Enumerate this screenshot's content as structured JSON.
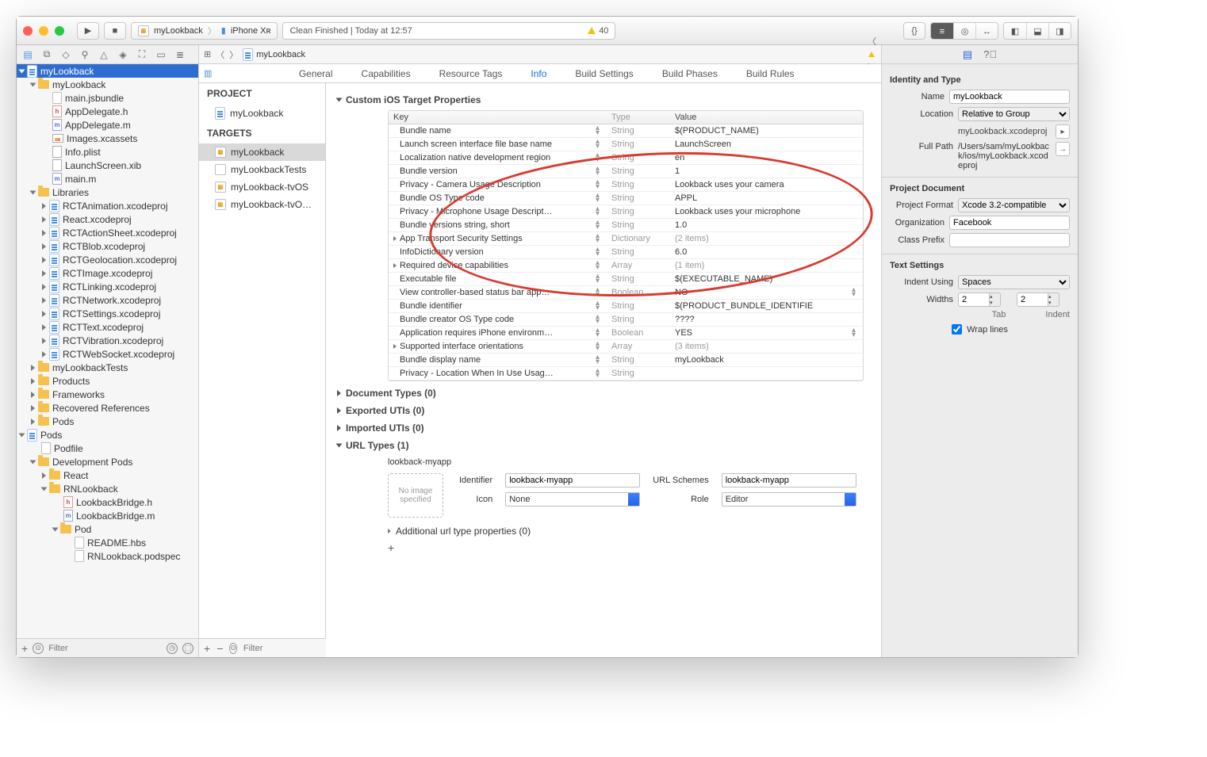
{
  "toolbar": {
    "scheme_target": "myLookback",
    "scheme_device": "iPhone Xʀ",
    "status_text": "Clean Finished | Today at 12:57",
    "warning_count": "40"
  },
  "navigator": {
    "root": "myLookback",
    "tree": [
      {
        "indent": 0,
        "type": "project",
        "name": "myLookback",
        "selected": true,
        "open": true
      },
      {
        "indent": 1,
        "type": "folder",
        "name": "myLookback",
        "open": true
      },
      {
        "indent": 2,
        "type": "file",
        "name": "main.jsbundle"
      },
      {
        "indent": 2,
        "type": "h",
        "name": "AppDelegate.h"
      },
      {
        "indent": 2,
        "type": "m",
        "name": "AppDelegate.m"
      },
      {
        "indent": 2,
        "type": "img",
        "name": "Images.xcassets"
      },
      {
        "indent": 2,
        "type": "plist",
        "name": "Info.plist"
      },
      {
        "indent": 2,
        "type": "xib",
        "name": "LaunchScreen.xib"
      },
      {
        "indent": 2,
        "type": "m",
        "name": "main.m"
      },
      {
        "indent": 1,
        "type": "folder",
        "name": "Libraries",
        "open": true
      },
      {
        "indent": 2,
        "type": "project",
        "name": "RCTAnimation.xcodeproj",
        "closed": true
      },
      {
        "indent": 2,
        "type": "project",
        "name": "React.xcodeproj",
        "closed": true
      },
      {
        "indent": 2,
        "type": "project",
        "name": "RCTActionSheet.xcodeproj",
        "closed": true
      },
      {
        "indent": 2,
        "type": "project",
        "name": "RCTBlob.xcodeproj",
        "closed": true
      },
      {
        "indent": 2,
        "type": "project",
        "name": "RCTGeolocation.xcodeproj",
        "closed": true
      },
      {
        "indent": 2,
        "type": "project",
        "name": "RCTImage.xcodeproj",
        "closed": true
      },
      {
        "indent": 2,
        "type": "project",
        "name": "RCTLinking.xcodeproj",
        "closed": true
      },
      {
        "indent": 2,
        "type": "project",
        "name": "RCTNetwork.xcodeproj",
        "closed": true
      },
      {
        "indent": 2,
        "type": "project",
        "name": "RCTSettings.xcodeproj",
        "closed": true
      },
      {
        "indent": 2,
        "type": "project",
        "name": "RCTText.xcodeproj",
        "closed": true
      },
      {
        "indent": 2,
        "type": "project",
        "name": "RCTVibration.xcodeproj",
        "closed": true
      },
      {
        "indent": 2,
        "type": "project",
        "name": "RCTWebSocket.xcodeproj",
        "closed": true
      },
      {
        "indent": 1,
        "type": "folder",
        "name": "myLookbackTests",
        "closed": true
      },
      {
        "indent": 1,
        "type": "folder",
        "name": "Products",
        "closed": true
      },
      {
        "indent": 1,
        "type": "folder",
        "name": "Frameworks",
        "closed": true
      },
      {
        "indent": 1,
        "type": "folder",
        "name": "Recovered References",
        "closed": true
      },
      {
        "indent": 1,
        "type": "folder",
        "name": "Pods",
        "closed": true
      },
      {
        "indent": 0,
        "type": "project",
        "name": "Pods",
        "open": true
      },
      {
        "indent": 1,
        "type": "file",
        "name": "Podfile",
        "ruby": true
      },
      {
        "indent": 1,
        "type": "folder",
        "name": "Development Pods",
        "open": true
      },
      {
        "indent": 2,
        "type": "folder",
        "name": "React",
        "closed": true
      },
      {
        "indent": 2,
        "type": "folder",
        "name": "RNLookback",
        "open": true
      },
      {
        "indent": 3,
        "type": "h",
        "name": "LookbackBridge.h"
      },
      {
        "indent": 3,
        "type": "m",
        "name": "LookbackBridge.m"
      },
      {
        "indent": 3,
        "type": "folder",
        "name": "Pod",
        "open": true
      },
      {
        "indent": 4,
        "type": "file",
        "name": "README.hbs"
      },
      {
        "indent": 4,
        "type": "file",
        "name": "RNLookback.podspec",
        "ruby": true
      }
    ],
    "filter_placeholder": "Filter"
  },
  "jumpbar": {
    "project": "myLookback"
  },
  "tabs": [
    "General",
    "Capabilities",
    "Resource Tags",
    "Info",
    "Build Settings",
    "Build Phases",
    "Build Rules"
  ],
  "active_tab": "Info",
  "targets_panel": {
    "project_header": "PROJECT",
    "project": "myLookback",
    "targets_header": "TARGETS",
    "targets": [
      "myLookback",
      "myLookbackTests",
      "myLookback-tvOS",
      "myLookback-tvO…"
    ],
    "selected_target": "myLookback",
    "filter_placeholder": "Filter"
  },
  "info": {
    "section_title": "Custom iOS Target Properties",
    "table_headers": {
      "key": "Key",
      "type": "Type",
      "value": "Value"
    },
    "rows": [
      {
        "key": "Bundle name",
        "type": "String",
        "value": "$(PRODUCT_NAME)"
      },
      {
        "key": "Launch screen interface file base name",
        "type": "String",
        "value": "LaunchScreen"
      },
      {
        "key": "Localization native development region",
        "type": "String",
        "value": "en"
      },
      {
        "key": "Bundle version",
        "type": "String",
        "value": "1"
      },
      {
        "key": "Privacy - Camera Usage Description",
        "type": "String",
        "value": "Lookback uses your camera"
      },
      {
        "key": "Bundle OS Type code",
        "type": "String",
        "value": "APPL"
      },
      {
        "key": "Privacy - Microphone Usage Descript…",
        "type": "String",
        "value": "Lookback uses your microphone"
      },
      {
        "key": "Bundle versions string, short",
        "type": "String",
        "value": "1.0"
      },
      {
        "key": "App Transport Security Settings",
        "type": "Dictionary",
        "value": "(2 items)",
        "expandable": true
      },
      {
        "key": "InfoDictionary version",
        "type": "String",
        "value": "6.0"
      },
      {
        "key": "Required device capabilities",
        "type": "Array",
        "value": "(1 item)",
        "expandable": true
      },
      {
        "key": "Executable file",
        "type": "String",
        "value": "$(EXECUTABLE_NAME)"
      },
      {
        "key": "View controller-based status bar app…",
        "type": "Boolean",
        "value": "NO"
      },
      {
        "key": "Bundle identifier",
        "type": "String",
        "value": "$(PRODUCT_BUNDLE_IDENTIFIE"
      },
      {
        "key": "Bundle creator OS Type code",
        "type": "String",
        "value": "????"
      },
      {
        "key": "Application requires iPhone environm…",
        "type": "Boolean",
        "value": "YES"
      },
      {
        "key": "Supported interface orientations",
        "type": "Array",
        "value": "(3 items)",
        "expandable": true
      },
      {
        "key": "Bundle display name",
        "type": "String",
        "value": "myLookback"
      },
      {
        "key": "Privacy - Location When In Use Usag…",
        "type": "String",
        "value": ""
      }
    ],
    "doc_types": "Document Types (0)",
    "exported_utis": "Exported UTIs (0)",
    "imported_utis": "Imported UTIs (0)",
    "url_types_header": "URL Types (1)",
    "url_type": {
      "name": "lookback-myapp",
      "identifier_label": "Identifier",
      "identifier": "lookback-myapp",
      "schemes_label": "URL Schemes",
      "schemes": "lookback-myapp",
      "icon_label": "Icon",
      "icon_value": "None",
      "role_label": "Role",
      "role_value": "Editor",
      "no_image": "No image specified",
      "additional": "Additional url type properties (0)"
    }
  },
  "inspector": {
    "identity_hdr": "Identity and Type",
    "name_label": "Name",
    "name": "myLookback",
    "location_label": "Location",
    "location": "Relative to Group",
    "location_file": "myLookback.xcodeproj",
    "fullpath_label": "Full Path",
    "fullpath": "/Users/sam/myLookback/ios/myLookback.xcodeproj",
    "projdoc_hdr": "Project Document",
    "format_label": "Project Format",
    "format": "Xcode 3.2-compatible",
    "org_label": "Organization",
    "org": "Facebook",
    "prefix_label": "Class Prefix",
    "prefix": "",
    "text_hdr": "Text Settings",
    "indent_using_label": "Indent Using",
    "indent_using": "Spaces",
    "widths_label": "Widths",
    "tab_width": "2",
    "indent_width": "2",
    "tab_label": "Tab",
    "indent_label": "Indent",
    "wrap_label": "Wrap lines"
  }
}
